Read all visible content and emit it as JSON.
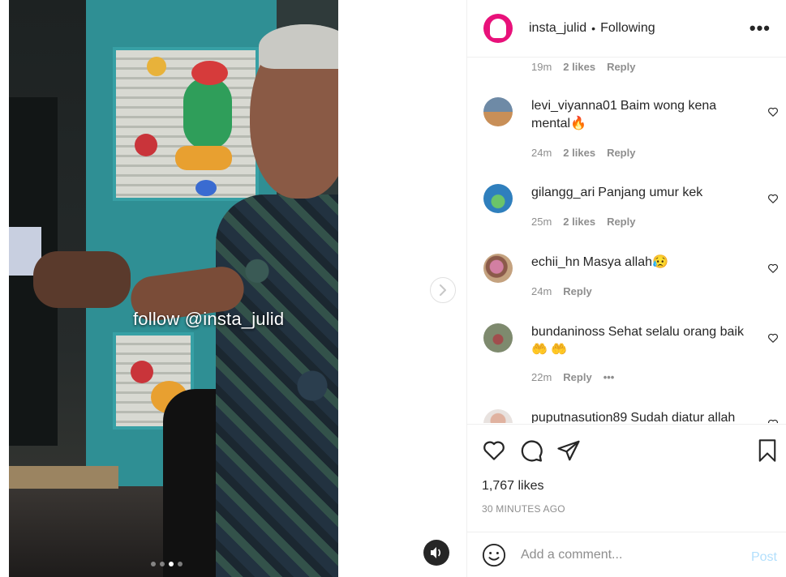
{
  "media": {
    "overlay_text": "follow @insta_julid",
    "carousel_dots": 4,
    "active_dot_index": 2,
    "next_icon": "chevron-right-icon",
    "sound_icon": "speaker-icon"
  },
  "header": {
    "username": "insta_julid",
    "separator": "•",
    "follow_status": "Following",
    "more_label": "•••"
  },
  "top_comment_meta": {
    "time": "19m",
    "likes": "2 likes",
    "reply": "Reply"
  },
  "comments": [
    {
      "username": "levi_viyanna01",
      "text": "Baim wong kena mental🔥",
      "time": "24m",
      "likes": "2 likes",
      "reply": "Reply"
    },
    {
      "username": "gilangg_ari",
      "text": "Panjang umur kek",
      "time": "25m",
      "likes": "2 likes",
      "reply": "Reply"
    },
    {
      "username": "echii_hn",
      "text": "Masya allah😥",
      "time": "24m",
      "likes": "",
      "reply": "Reply"
    },
    {
      "username": "bundaninoss",
      "text": "Sehat selalu orang baik🤲 🤲",
      "time": "22m",
      "likes": "",
      "reply": "Reply",
      "more": "•••"
    },
    {
      "username": "puputnasution89",
      "text": "Sudah diatur allah",
      "time": "",
      "likes": "",
      "reply": ""
    }
  ],
  "actions": {
    "likes": "1,767 likes",
    "time_ago": "30 MINUTES AGO"
  },
  "add_comment": {
    "placeholder": "Add a comment...",
    "post_label": "Post"
  },
  "colors": {
    "text": "#262626",
    "secondary": "#8e8e8e",
    "border": "#efefef",
    "post_disabled": "#b2dffc",
    "avatar_brand": "#e8117a"
  }
}
